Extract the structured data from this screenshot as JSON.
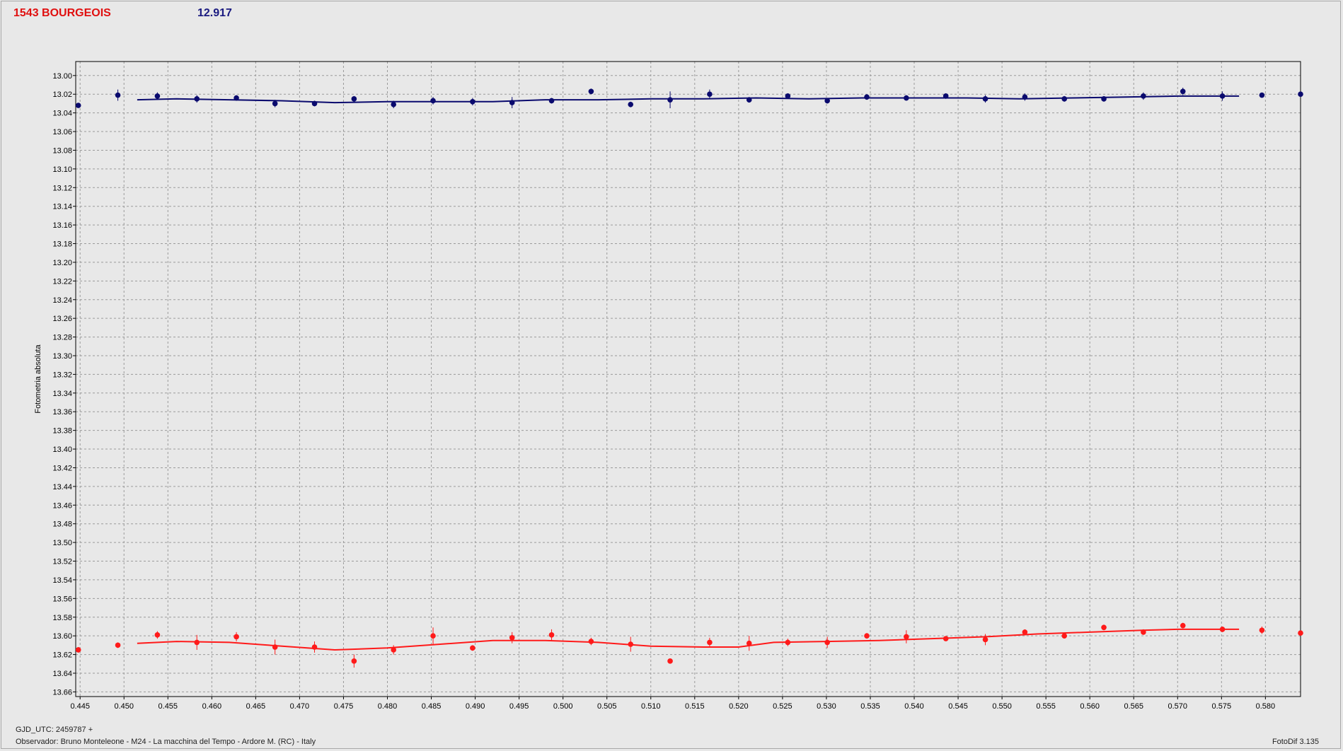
{
  "header": {
    "title": "1543 BOURGEOIS",
    "value": "12.917"
  },
  "footer": {
    "gjd": "GJD_UTC: 2459787 +",
    "observer": "Observador: Bruno Monteleone - M24 - La macchina del Tempo - Ardore M. (RC) - Italy",
    "version": "FotoDif 3.135"
  },
  "colors": {
    "series_blue": "#0a0a6e",
    "series_red": "#ff1a1a",
    "title": "#e01010",
    "value": "#1a1a80"
  },
  "chart_data": {
    "type": "scatter",
    "ylabel": "Fotometria absoluta",
    "xlabel": "",
    "xlim": [
      0.4445,
      0.584
    ],
    "ylim": [
      13.665,
      12.985
    ],
    "y_inverted": true,
    "grid": true,
    "x_ticks": [
      "0.445",
      "0.450",
      "0.455",
      "0.460",
      "0.465",
      "0.470",
      "0.475",
      "0.480",
      "0.485",
      "0.490",
      "0.495",
      "0.500",
      "0.505",
      "0.510",
      "0.515",
      "0.520",
      "0.525",
      "0.530",
      "0.535",
      "0.540",
      "0.545",
      "0.550",
      "0.555",
      "0.560",
      "0.565",
      "0.570",
      "0.575",
      "0.580"
    ],
    "y_ticks": [
      "13.00",
      "13.02",
      "13.04",
      "13.06",
      "13.08",
      "13.10",
      "13.12",
      "13.14",
      "13.16",
      "13.18",
      "13.20",
      "13.22",
      "13.24",
      "13.26",
      "13.28",
      "13.30",
      "13.32",
      "13.34",
      "13.36",
      "13.38",
      "13.40",
      "13.42",
      "13.44",
      "13.46",
      "13.48",
      "13.50",
      "13.52",
      "13.54",
      "13.56",
      "13.58",
      "13.60",
      "13.62",
      "13.64",
      "13.66"
    ],
    "series": [
      {
        "color": "#0a0a6e",
        "x": [
          0.4448,
          0.4493,
          0.4538,
          0.4583,
          0.4628,
          0.4672,
          0.4717,
          0.4762,
          0.4807,
          0.4852,
          0.4897,
          0.4942,
          0.4987,
          0.5032,
          0.5077,
          0.5122,
          0.5167,
          0.5212,
          0.5256,
          0.5301,
          0.5346,
          0.5391,
          0.5436,
          0.5481,
          0.5526,
          0.5571,
          0.5616,
          0.5661,
          0.5706,
          0.5751,
          0.5796,
          0.584
        ],
        "y": [
          13.032,
          13.021,
          13.022,
          13.025,
          13.024,
          13.03,
          13.03,
          13.025,
          13.031,
          13.027,
          13.028,
          13.029,
          13.027,
          13.017,
          13.031,
          13.026,
          13.02,
          13.026,
          13.022,
          13.027,
          13.023,
          13.024,
          13.022,
          13.025,
          13.023,
          13.025,
          13.025,
          13.022,
          13.017,
          13.022,
          13.021,
          13.02
        ],
        "err": [
          0.002,
          0.006,
          0.004,
          0.004,
          0.003,
          0.004,
          0.003,
          0.003,
          0.004,
          0.004,
          0.004,
          0.006,
          0.003,
          0.003,
          0.003,
          0.009,
          0.005,
          0.003,
          0.003,
          0.003,
          0.003,
          0.003,
          0.003,
          0.004,
          0.004,
          0.003,
          0.003,
          0.004,
          0.004,
          0.005,
          0.002,
          0.002
        ],
        "fit_x": [
          0.4515,
          0.456,
          0.462,
          0.468,
          0.474,
          0.48,
          0.486,
          0.492,
          0.498,
          0.504,
          0.51,
          0.516,
          0.522,
          0.528,
          0.534,
          0.54,
          0.546,
          0.552,
          0.558,
          0.564,
          0.57,
          0.577
        ],
        "fit_y": [
          13.026,
          13.025,
          13.026,
          13.027,
          13.029,
          13.028,
          13.028,
          13.028,
          13.026,
          13.026,
          13.025,
          13.025,
          13.024,
          13.025,
          13.024,
          13.024,
          13.024,
          13.025,
          13.024,
          13.023,
          13.022,
          13.022
        ]
      },
      {
        "color": "#ff1a1a",
        "x": [
          0.4448,
          0.4493,
          0.4538,
          0.4583,
          0.4628,
          0.4672,
          0.4717,
          0.4762,
          0.4807,
          0.4852,
          0.4897,
          0.4942,
          0.4987,
          0.5032,
          0.5077,
          0.5122,
          0.5167,
          0.5212,
          0.5256,
          0.5301,
          0.5346,
          0.5391,
          0.5436,
          0.5481,
          0.5526,
          0.5571,
          0.5616,
          0.5661,
          0.5706,
          0.5751,
          0.5796,
          0.584
        ],
        "y": [
          13.615,
          13.61,
          13.599,
          13.607,
          13.601,
          13.612,
          13.612,
          13.627,
          13.615,
          13.6,
          13.613,
          13.602,
          13.599,
          13.606,
          13.609,
          13.627,
          13.607,
          13.608,
          13.607,
          13.607,
          13.6,
          13.601,
          13.603,
          13.604,
          13.596,
          13.6,
          13.591,
          13.596,
          13.589,
          13.593,
          13.594,
          13.597
        ],
        "err": [
          0.003,
          0.003,
          0.004,
          0.008,
          0.005,
          0.008,
          0.006,
          0.007,
          0.005,
          0.009,
          0.003,
          0.006,
          0.006,
          0.004,
          0.008,
          0.002,
          0.005,
          0.008,
          0.004,
          0.006,
          0.003,
          0.007,
          0.002,
          0.006,
          0.003,
          0.002,
          0.003,
          0.003,
          0.003,
          0.003,
          0.004,
          0.002
        ],
        "fit_x": [
          0.4515,
          0.456,
          0.462,
          0.468,
          0.474,
          0.48,
          0.486,
          0.492,
          0.498,
          0.504,
          0.51,
          0.516,
          0.52,
          0.524,
          0.53,
          0.536,
          0.542,
          0.548,
          0.554,
          0.56,
          0.566,
          0.57,
          0.577
        ],
        "fit_y": [
          13.608,
          13.606,
          13.607,
          13.611,
          13.615,
          13.613,
          13.609,
          13.605,
          13.605,
          13.607,
          13.611,
          13.612,
          13.612,
          13.607,
          13.606,
          13.605,
          13.603,
          13.601,
          13.598,
          13.596,
          13.594,
          13.593,
          13.593
        ]
      }
    ]
  }
}
